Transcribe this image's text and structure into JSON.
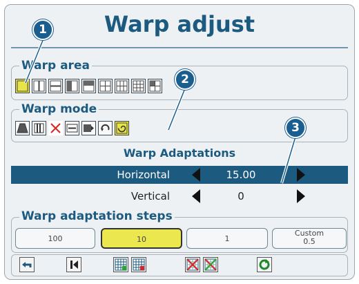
{
  "header": {
    "title": "Warp adjust"
  },
  "warp_area": {
    "label": "Warp area",
    "buttons": [
      "full-area-icon",
      "vertical-halves-icon",
      "horizontal-halves-icon",
      "vertical-split-icon",
      "horizontal-split-icon",
      "quadrants-icon",
      "grid-6-icon",
      "grid-9-icon",
      "quad-grid-icon"
    ],
    "selected": 0
  },
  "warp_mode": {
    "label": "Warp mode",
    "buttons": [
      "keystone-icon",
      "bow-columns-icon",
      "cross-diagonal-icon",
      "horizontal-stretch-icon",
      "rotate-corner-icon",
      "rotate-icon",
      "spiral-warp-icon"
    ],
    "selected": 6
  },
  "adaptations": {
    "title": "Warp Adaptations",
    "rows": [
      {
        "label": "Horizontal",
        "value": "15.00",
        "highlighted": true
      },
      {
        "label": "Vertical",
        "value": "0",
        "highlighted": false
      }
    ]
  },
  "steps": {
    "label": "Warp adaptation steps",
    "options": [
      {
        "label": "100"
      },
      {
        "label": "10"
      },
      {
        "label": "1"
      },
      {
        "label": "Custom",
        "sub": "0.5"
      }
    ],
    "selected": 1
  },
  "toolbar": {
    "buttons": [
      "undo-icon",
      "reset-to-start-icon",
      "grid-add-icon",
      "grid-remove-icon",
      "cross-grid-icon",
      "cross-grid-alt-icon",
      "refresh-green-icon"
    ]
  },
  "callouts": [
    "1",
    "2",
    "3"
  ],
  "colors": {
    "accent": "#1c5a80",
    "selected": "#e8e54a",
    "callout": "#1a5e90"
  }
}
